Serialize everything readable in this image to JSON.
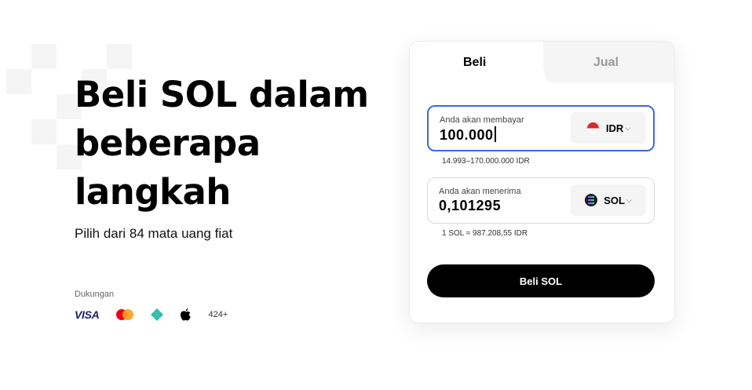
{
  "hero": {
    "title_line1": "Beli SOL dalam",
    "title_line2": "beberapa",
    "title_line3": "langkah",
    "subtitle": "Pilih dari 84 mata uang fiat"
  },
  "support": {
    "label": "Dukungan",
    "methods": [
      {
        "name": "VISA",
        "icon": "visa-logo"
      },
      {
        "name": "Mastercard",
        "icon": "mastercard-icon"
      },
      {
        "name": "Pix",
        "icon": "pix-icon"
      },
      {
        "name": "Apple Pay",
        "icon": "apple-icon"
      }
    ],
    "more": "424+"
  },
  "widget": {
    "tabs": [
      {
        "label": "Beli",
        "active": true
      },
      {
        "label": "Jual",
        "active": false
      }
    ],
    "pay": {
      "label": "Anda akan membayar",
      "value": "100.000",
      "currency": "IDR",
      "currency_icon": "indonesia-flag-icon",
      "hint": "14.993–170.000.000 IDR"
    },
    "receive": {
      "label": "Anda akan menerima",
      "value": "0,101295",
      "currency": "SOL",
      "currency_icon": "solana-icon",
      "hint": "1 SOL ≈ 987.208,55 IDR"
    },
    "button_label": "Beli SOL"
  },
  "colors": {
    "accent_border": "#3b6ae8",
    "button_bg": "#000000",
    "inactive_tab_text": "#9a9a9a",
    "mastercard_red": "#eb001b",
    "mastercard_orange": "#f79e1b",
    "pix_teal": "#32bcad"
  }
}
